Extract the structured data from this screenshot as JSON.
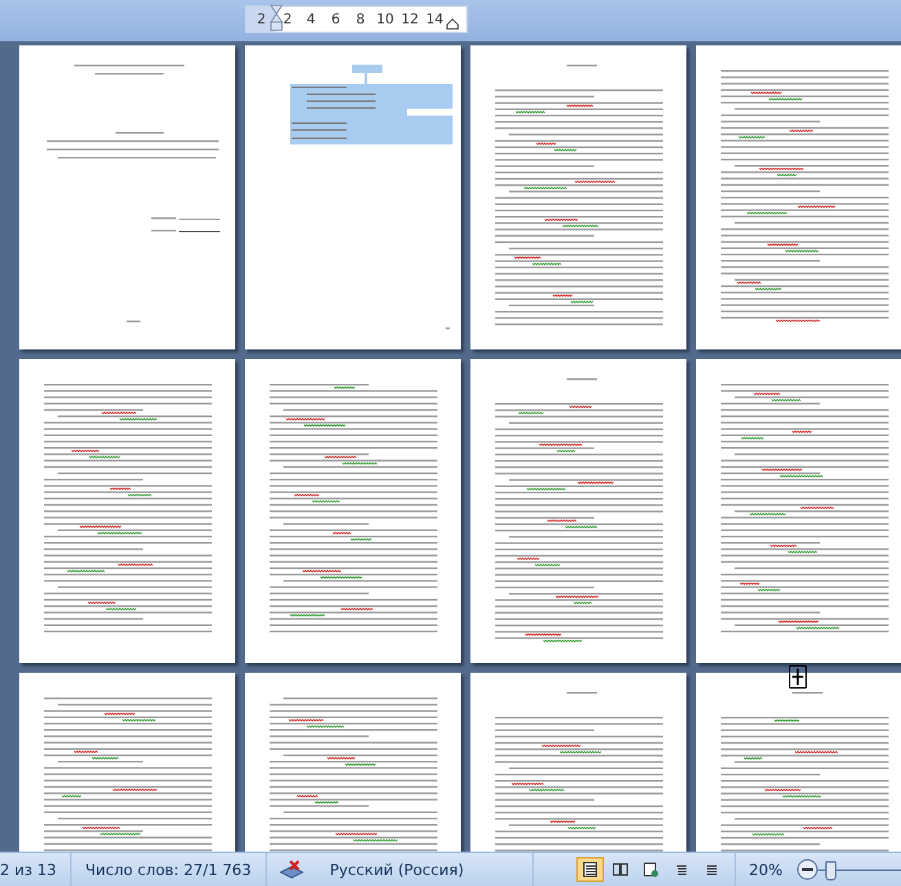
{
  "ruler": {
    "ticks": [
      "2",
      "2",
      "4",
      "6",
      "8",
      "10",
      "12",
      "14"
    ]
  },
  "pages": [
    {
      "kind": "title"
    },
    {
      "kind": "toc"
    },
    {
      "kind": "text"
    },
    {
      "kind": "text"
    },
    {
      "kind": "text"
    },
    {
      "kind": "text"
    },
    {
      "kind": "text"
    },
    {
      "kind": "text"
    },
    {
      "kind": "text"
    },
    {
      "kind": "text"
    },
    {
      "kind": "text"
    },
    {
      "kind": "text"
    }
  ],
  "status_bar": {
    "page": "2 из 13",
    "words": "Число слов: 27/1 763",
    "language": "Русский (Россия)",
    "views": [
      {
        "selected": true
      },
      {
        "selected": false
      },
      {
        "selected": false
      },
      {
        "selected": false
      },
      {
        "selected": false
      }
    ],
    "zoom": "20%",
    "zoom_slider": {
      "level": 0.1
    }
  }
}
